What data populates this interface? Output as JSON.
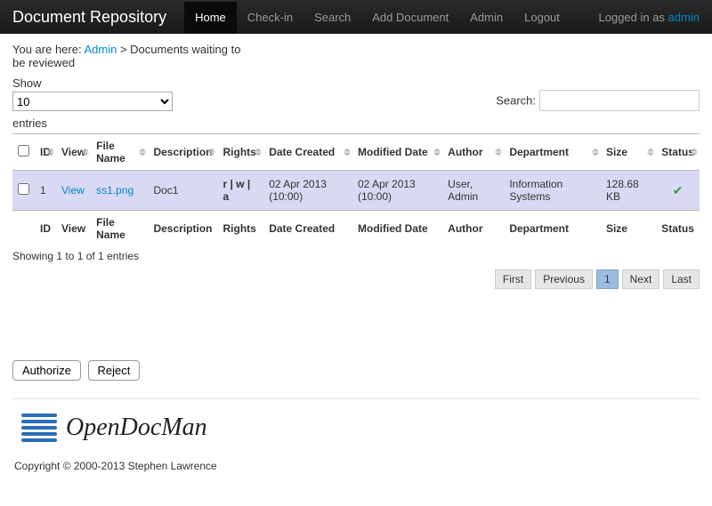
{
  "nav": {
    "brand": "Document Repository",
    "items": [
      "Home",
      "Check-in",
      "Search",
      "Add Document",
      "Admin",
      "Logout"
    ],
    "logged_in_prefix": "Logged in as ",
    "user": "admin"
  },
  "breadcrumb": {
    "prefix": "You are here: ",
    "admin": "Admin",
    "sep": " > ",
    "page": "Documents waiting to be reviewed"
  },
  "dt": {
    "show_label": "Show",
    "length_value": "10",
    "entries_label": "entries",
    "search_label": "Search:",
    "search_value": "",
    "info": "Showing 1 to 1 of 1 entries"
  },
  "columns": [
    "",
    "ID",
    "View",
    "File Name",
    "Description",
    "Rights",
    "Date Created",
    "Modified Date",
    "Author",
    "Department",
    "Size",
    "Status"
  ],
  "footer_columns": [
    "",
    "ID",
    "View",
    "File Name",
    "Description",
    "Rights",
    "Date Created",
    "Modified Date",
    "Author",
    "Department",
    "Size",
    "Status"
  ],
  "rows": [
    {
      "id": "1",
      "view": "View",
      "file_name": "ss1.png",
      "description": "Doc1",
      "rights": "r | w | a",
      "date_created": "02 Apr 2013 (10:00)",
      "modified_date": "02 Apr 2013 (10:00)",
      "author": "User, Admin",
      "department": "Information Systems",
      "size": "128.68 KB",
      "status_ok": true
    }
  ],
  "pagination": {
    "first": "First",
    "previous": "Previous",
    "pages": [
      "1"
    ],
    "next": "Next",
    "last": "Last"
  },
  "actions": {
    "authorize": "Authorize",
    "reject": "Reject"
  },
  "footer": {
    "product": "OpenDocMan",
    "copyright": "Copyright © 2000-2013 Stephen Lawrence"
  }
}
